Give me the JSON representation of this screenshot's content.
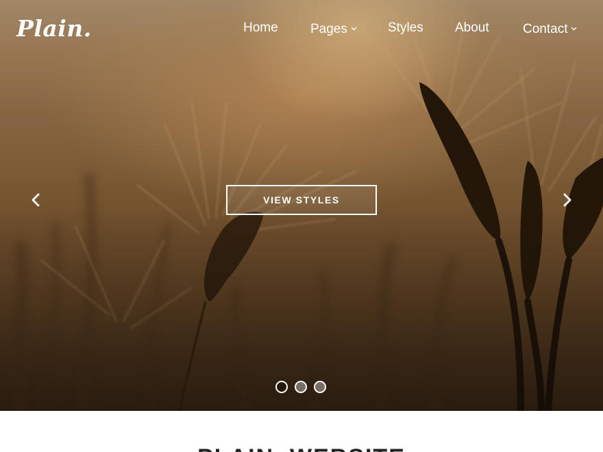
{
  "brand": {
    "logo_text": "Plain."
  },
  "nav": {
    "items": [
      {
        "label": "Home",
        "has_dropdown": false
      },
      {
        "label": "Pages",
        "has_dropdown": true
      },
      {
        "label": "Styles",
        "has_dropdown": false
      },
      {
        "label": "About",
        "has_dropdown": false
      },
      {
        "label": "Contact",
        "has_dropdown": true
      }
    ]
  },
  "hero": {
    "cta_label": "VIEW STYLES",
    "prev_icon": "chevron-left-icon",
    "next_icon": "chevron-right-icon",
    "slides": {
      "count": 3,
      "active_index": 0
    }
  },
  "section": {
    "heading": "PLAIN. WEBSITE"
  },
  "colors": {
    "text_light": "#ffffff",
    "heading": "#222222"
  }
}
